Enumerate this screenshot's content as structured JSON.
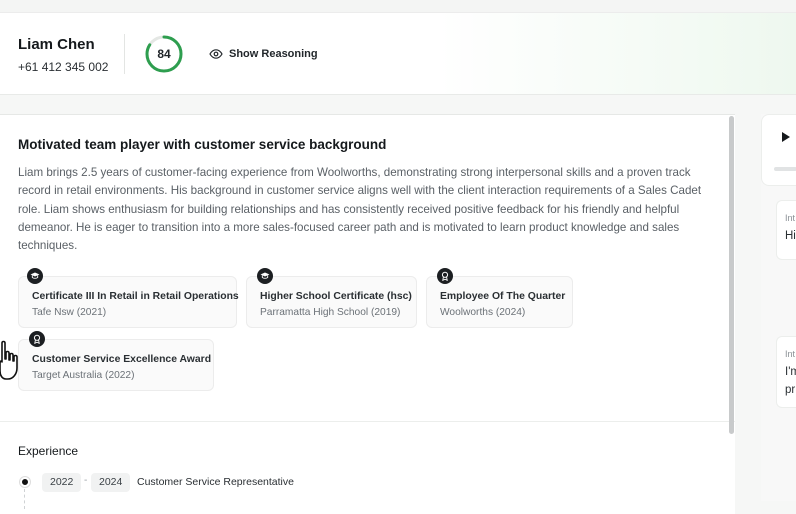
{
  "candidate": {
    "name": "Liam Chen",
    "phone": "+61 412 345 002",
    "score": 84,
    "show_reasoning_label": "Show Reasoning"
  },
  "summary": {
    "title": "Motivated team player with customer service background",
    "body": "Liam brings 2.5 years of customer-facing experience from Woolworths, demonstrating strong interpersonal skills and a proven track record in retail environments. His background in customer service aligns well with the client interaction requirements of a Sales Cadet role. Liam shows enthusiasm for building relationships and has consistently received positive feedback for his friendly and helpful demeanor. He is eager to transition into a more sales-focused career path and is motivated to learn product knowledge and sales techniques."
  },
  "badges": [
    {
      "icon": "graduation-cap-icon",
      "title": "Certificate III In Retail in Retail Operations",
      "subtitle": "Tafe Nsw (2021)"
    },
    {
      "icon": "graduation-cap-icon",
      "title": "Higher School Certificate (hsc)",
      "subtitle": "Parramatta High School (2019)"
    },
    {
      "icon": "award-icon",
      "title": "Employee Of The Quarter",
      "subtitle": "Woolworths (2024)"
    },
    {
      "icon": "award-icon",
      "title": "Customer Service Excellence Award",
      "subtitle": "Target Australia (2022)"
    }
  ],
  "experience": {
    "title": "Experience",
    "items": [
      {
        "start": "2022",
        "separator": "-",
        "end": "2024",
        "role": "Customer Service Representative"
      }
    ]
  },
  "right_panel": {
    "messages": [
      {
        "label": "Int",
        "text": "Hi"
      },
      {
        "label": "Int",
        "text": "I'm",
        "text2": "pr"
      }
    ]
  },
  "colors": {
    "score_ring": "#2e9e4f",
    "score_track": "#e4e7e4",
    "accent_bg": "#eef8ef"
  }
}
